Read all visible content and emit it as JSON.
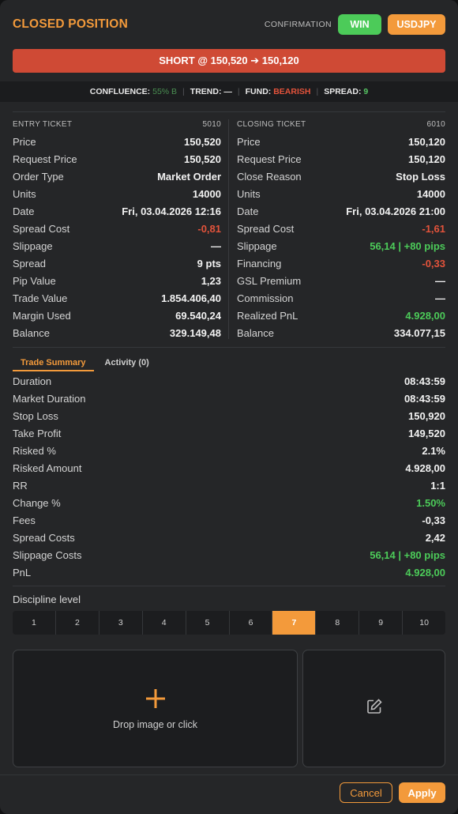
{
  "header": {
    "title": "CLOSED POSITION",
    "confirmation_label": "CONFIRMATION",
    "result_badge": "WIN",
    "symbol_badge": "USDJPY"
  },
  "banner": {
    "text": "SHORT @ 150,520 ➔ 150,120"
  },
  "strip": {
    "confluence_label": "CONFLUENCE:",
    "confluence_value": "55% B",
    "trend_label": "TREND:",
    "trend_value": "—",
    "fund_label": "FUND:",
    "fund_value": "BEARISH",
    "spread_label": "SPREAD:",
    "spread_value": "9"
  },
  "entry_ticket": {
    "title": "ENTRY TICKET",
    "id": "5010",
    "rows": [
      {
        "label": "Price",
        "value": "150,520",
        "tone": ""
      },
      {
        "label": "Request Price",
        "value": "150,520",
        "tone": ""
      },
      {
        "label": "Order Type",
        "value": "Market Order",
        "tone": ""
      },
      {
        "label": "Units",
        "value": "14000",
        "tone": ""
      },
      {
        "label": "Date",
        "value": "Fri, 03.04.2026 12:16",
        "tone": ""
      },
      {
        "label": "Spread Cost",
        "value": "-0,81",
        "tone": "red"
      },
      {
        "label": "Slippage",
        "value": "—",
        "tone": ""
      },
      {
        "label": "Spread",
        "value": "9 pts",
        "tone": ""
      },
      {
        "label": "Pip Value",
        "value": "1,23",
        "tone": ""
      },
      {
        "label": "Trade Value",
        "value": "1.854.406,40",
        "tone": ""
      },
      {
        "label": "Margin Used",
        "value": "69.540,24",
        "tone": ""
      },
      {
        "label": "Balance",
        "value": "329.149,48",
        "tone": ""
      }
    ]
  },
  "closing_ticket": {
    "title": "CLOSING TICKET",
    "id": "6010",
    "rows": [
      {
        "label": "Price",
        "value": "150,120",
        "tone": ""
      },
      {
        "label": "Request Price",
        "value": "150,120",
        "tone": ""
      },
      {
        "label": "Close Reason",
        "value": "Stop Loss",
        "tone": ""
      },
      {
        "label": "Units",
        "value": "14000",
        "tone": ""
      },
      {
        "label": "Date",
        "value": "Fri, 03.04.2026 21:00",
        "tone": ""
      },
      {
        "label": "Spread Cost",
        "value": "-1,61",
        "tone": "red"
      },
      {
        "label": "Slippage",
        "value": "56,14 | +80 pips",
        "tone": "green"
      },
      {
        "label": "Financing",
        "value": "-0,33",
        "tone": "red"
      },
      {
        "label": "GSL Premium",
        "value": "—",
        "tone": ""
      },
      {
        "label": "Commission",
        "value": "—",
        "tone": ""
      },
      {
        "label": "Realized PnL",
        "value": "4.928,00",
        "tone": "green"
      },
      {
        "label": "Balance",
        "value": "334.077,15",
        "tone": ""
      }
    ]
  },
  "tabs": [
    {
      "label": "Trade Summary",
      "active": true
    },
    {
      "label": "Activity (0)",
      "active": false
    }
  ],
  "trade_summary": [
    {
      "label": "Duration",
      "value": "08:43:59",
      "tone": ""
    },
    {
      "label": "Market Duration",
      "value": "08:43:59",
      "tone": ""
    },
    {
      "label": "Stop Loss",
      "value": "150,920",
      "tone": ""
    },
    {
      "label": "Take Profit",
      "value": "149,520",
      "tone": ""
    },
    {
      "label": "Risked %",
      "value": "2.1%",
      "tone": ""
    },
    {
      "label": "Risked Amount",
      "value": "4.928,00",
      "tone": ""
    },
    {
      "label": "RR",
      "value": "1:1",
      "tone": ""
    },
    {
      "label": "Change %",
      "value": "1.50%",
      "tone": "green"
    },
    {
      "label": "Fees",
      "value": "-0,33",
      "tone": ""
    },
    {
      "label": "Spread Costs",
      "value": "2,42",
      "tone": ""
    },
    {
      "label": "Slippage Costs",
      "value": "56,14 | +80 pips",
      "tone": "green"
    },
    {
      "label": "PnL",
      "value": "4.928,00",
      "tone": "green"
    }
  ],
  "discipline": {
    "label": "Discipline level",
    "levels": [
      "1",
      "2",
      "3",
      "4",
      "5",
      "6",
      "7",
      "8",
      "9",
      "10"
    ],
    "selected": "7"
  },
  "dropzone": {
    "icon": "plus-icon",
    "text": "Drop image or click"
  },
  "note_icon": "edit-note-icon",
  "footer": {
    "cancel_label": "Cancel",
    "apply_label": "Apply"
  },
  "colors": {
    "accent": "#f39a3b",
    "win": "#4ccb59",
    "loss": "#e3533b",
    "banner": "#cf4a35",
    "panel": "#252628"
  }
}
